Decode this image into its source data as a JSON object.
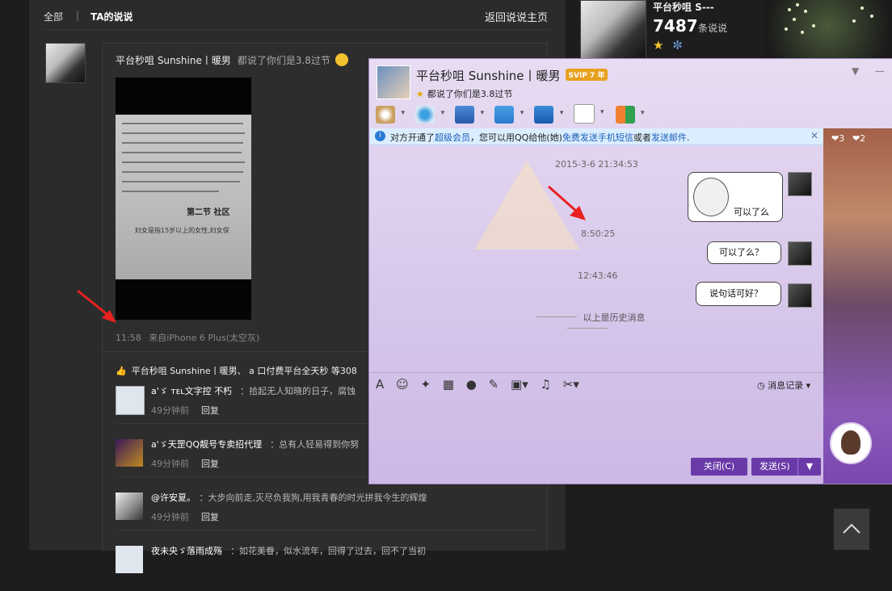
{
  "feed": {
    "nav": {
      "all": "全部",
      "sep": "|",
      "mine": "TA的说说",
      "back": "返回说说主页"
    },
    "post": {
      "author": "平台秒咀 Sunshine丨暖男",
      "said": "都说了你们是3.8过节",
      "photo_section": "第二节  社区",
      "photo_text": "妇女是指15岁以上的女性,妇女保",
      "time": "11:58",
      "source": "来自iPhone 6 Plus(太空灰)",
      "likes": "平台秒咀 Sunshine丨暖男、 a 口付费平台全天秒 等308",
      "comments": [
        {
          "name": "a'ゞ ᴛᴇʟ文字控 不朽",
          "text": "：拾起无人知晓的日子，腐蚀",
          "time": "49分钟前",
          "reply": "回复"
        },
        {
          "name": "a'ゞ天罡QQ靓号专卖招代理",
          "text": "：总有人轻易得到你努",
          "time": "49分钟前",
          "reply": "回复"
        },
        {
          "name": "@许安夏。",
          "text": "：大步向前走,灭尽负我狗,用我青春的时光拼我今生的辉煌",
          "time": "49分钟前",
          "reply": "回复"
        },
        {
          "name": "夜未央ゞ落雨成殇",
          "text": "：如花美眷，似水流年，回得了过去，回不了当初",
          "time": "",
          "reply": ""
        }
      ]
    }
  },
  "profile": {
    "name": "平台秒咀 S---",
    "count": "7487",
    "count_unit": "条说说"
  },
  "qq": {
    "name": "平台秒咀 Sunshine丨暖男",
    "svip": "SVIP 7 年",
    "signature": "都说了你们是3.8过节",
    "notice": {
      "pre": "对方开通了",
      "link1": "超级会员",
      "mid": "，您可以用QQ给他(她)",
      "link2": "免费发送手机短信",
      "mid2": "或者",
      "link3": "发送邮件",
      "post": "."
    },
    "messages": [
      {
        "time": "2015-3-6 21:34:53",
        "text": "可以了么"
      },
      {
        "time": "8:50:25",
        "text": "可以了么？"
      },
      {
        "time": "12:43:46",
        "text": "说句话可好？"
      }
    ],
    "history": "以上是历史消息",
    "msg_record": "消息记录",
    "close_btn": "关闭(C)",
    "send_btn": "发送(S)",
    "side_hearts": [
      "3",
      "2"
    ]
  }
}
